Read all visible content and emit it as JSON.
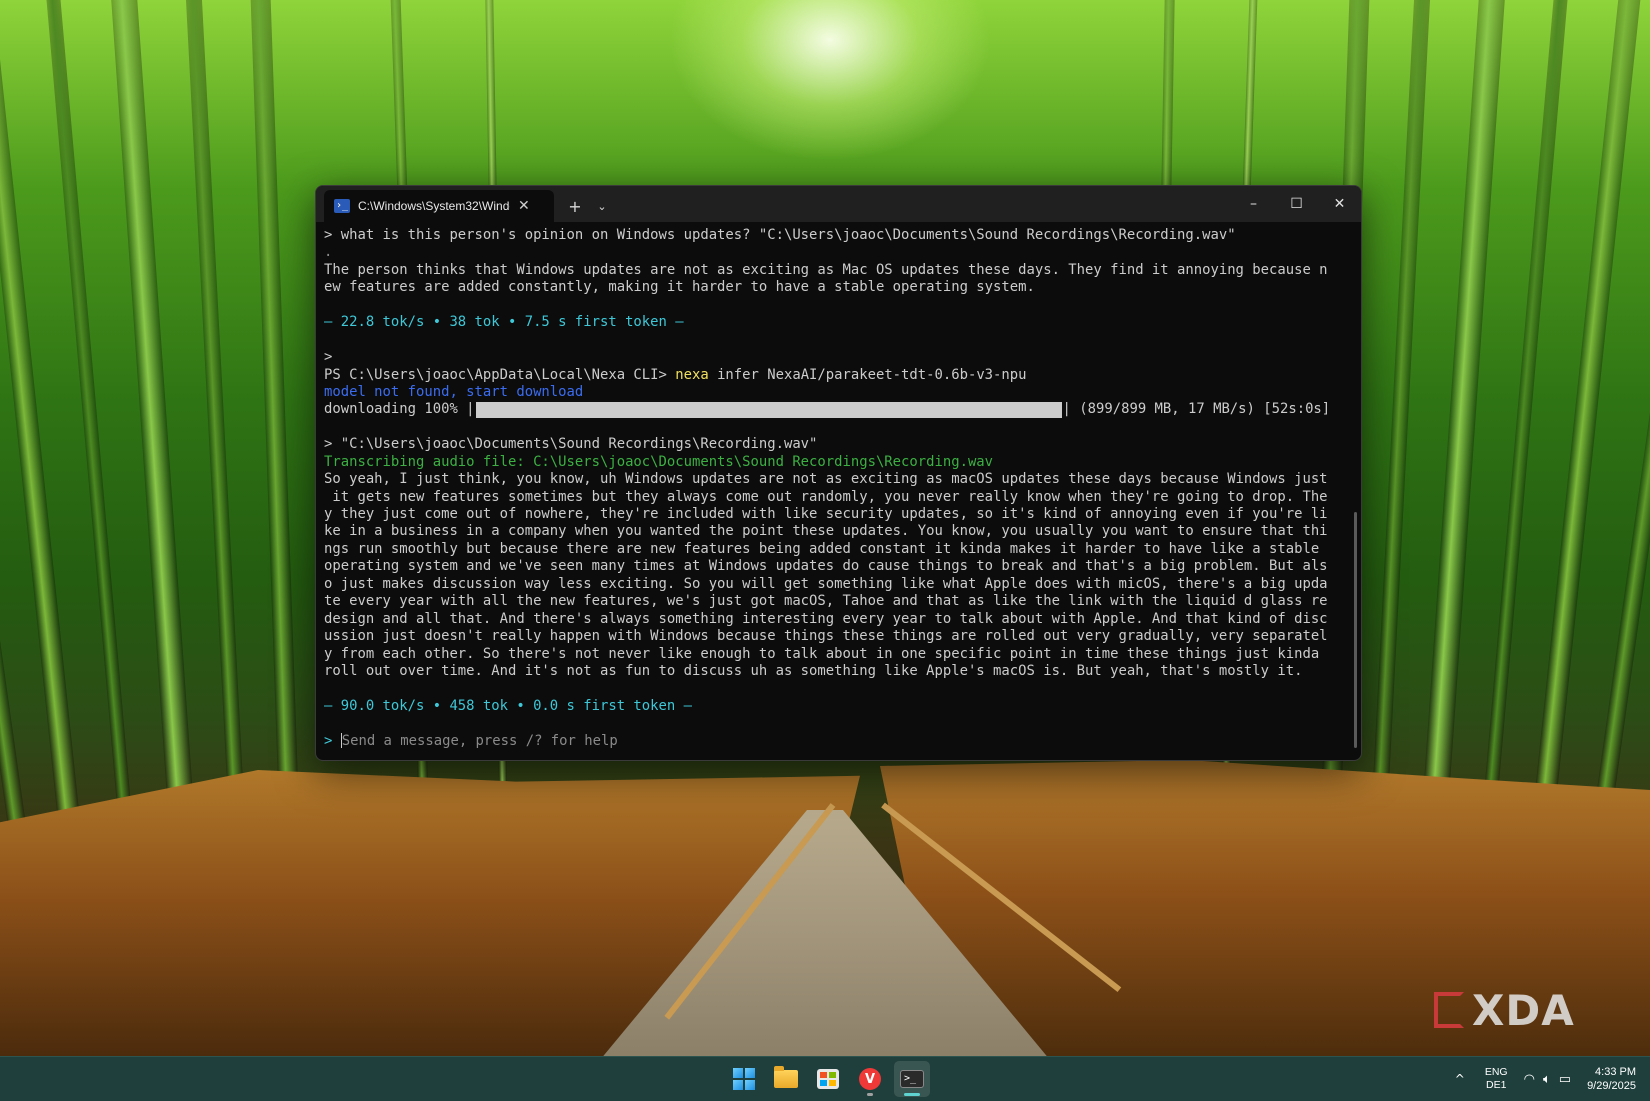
{
  "window": {
    "tab_title": "C:\\Windows\\System32\\Windc",
    "new_tab_label": "+",
    "dropdown_label": "⌄",
    "minimize_label": "–",
    "maximize_label": "☐",
    "close_label": "✕",
    "tab_close_label": "✕"
  },
  "terminal": {
    "l01": "> what is this person's opinion on Windows updates? \"C:\\Users\\joaoc\\Documents\\Sound Recordings\\Recording.wav\"",
    "l02": ".",
    "l03": "The person thinks that Windows updates are not as exciting as Mac OS updates these days. They find it annoying because n",
    "l04": "ew features are added constantly, making it harder to have a stable operating system.",
    "l05": "— 22.8 tok/s • 38 tok • 7.5 s first token —",
    "l06": ">",
    "l07_prompt": "PS C:\\Users\\joaoc\\AppData\\Local\\Nexa CLI> ",
    "l07_cmd": "nexa",
    "l07_args": " infer NexaAI/parakeet-tdt-0.6b-v3-npu",
    "l08": "model not found, start download",
    "l09_label": "downloading 100% |",
    "l09_stats": "| (899/899 MB, 17 MB/s) [52s:0s]",
    "progress": 1.0,
    "l10": "> \"C:\\Users\\joaoc\\Documents\\Sound Recordings\\Recording.wav\"",
    "l11": "Transcribing audio file: C:\\Users\\joaoc\\Documents\\Sound Recordings\\Recording.wav",
    "t01": "So yeah, I just think, you know, uh Windows updates are not as exciting as macOS updates these days because Windows just",
    "t02": " it gets new features sometimes but they always come out randomly, you never really know when they're going to drop. The",
    "t03": "y they just come out of nowhere, they're included with like security updates, so it's kind of annoying even if you're li",
    "t04": "ke in a business in a company when you wanted the point these updates. You know, you usually you want to ensure that thi",
    "t05": "ngs run smoothly but because there are new features being added constant it kinda makes it harder to have like a stable",
    "t06": "operating system and we've seen many times at Windows updates do cause things to break and that's a big problem. But als",
    "t07": "o just makes discussion way less exciting. So you will get something like what Apple does with micOS, there's a big upda",
    "t08": "te every year with all the new features, we's just got macOS, Tahoe and that as like the link with the liquid d glass re",
    "t09": "design and all that. And there's always something interesting every year to talk about with Apple. And that kind of disc",
    "t10": "ussion just doesn't really happen with Windows because things these things are rolled out very gradually, very separatel",
    "t11": "y from each other. So there's not never like enough to talk about in one specific point in time these things just kinda",
    "t12": "roll out over time. And it's not as fun to discuss uh as something like Apple's macOS is. But yeah, that's mostly it.",
    "l12": "— 90.0 tok/s • 458 tok • 0.0 s first token —",
    "input_prompt": "> ",
    "input_placeholder": "Send a message, press /? for help"
  },
  "watermark": {
    "brand": "XDA"
  },
  "taskbar": {
    "apps": [
      "start-icon",
      "file-explorer-icon",
      "microsoft-store-icon",
      "vivaldi-icon",
      "terminal-icon"
    ],
    "tray_chevron": "^",
    "lang_line1": "ENG",
    "lang_line2": "DE1",
    "time": "4:33 PM",
    "date": "9/29/2025"
  },
  "colors": {
    "terminal_bg": "#0c0c0c",
    "stats_cyan": "#3ec8d8",
    "success_green": "#3cb043",
    "info_blue": "#3b6cf0",
    "command_yellow": "#f0e060"
  }
}
